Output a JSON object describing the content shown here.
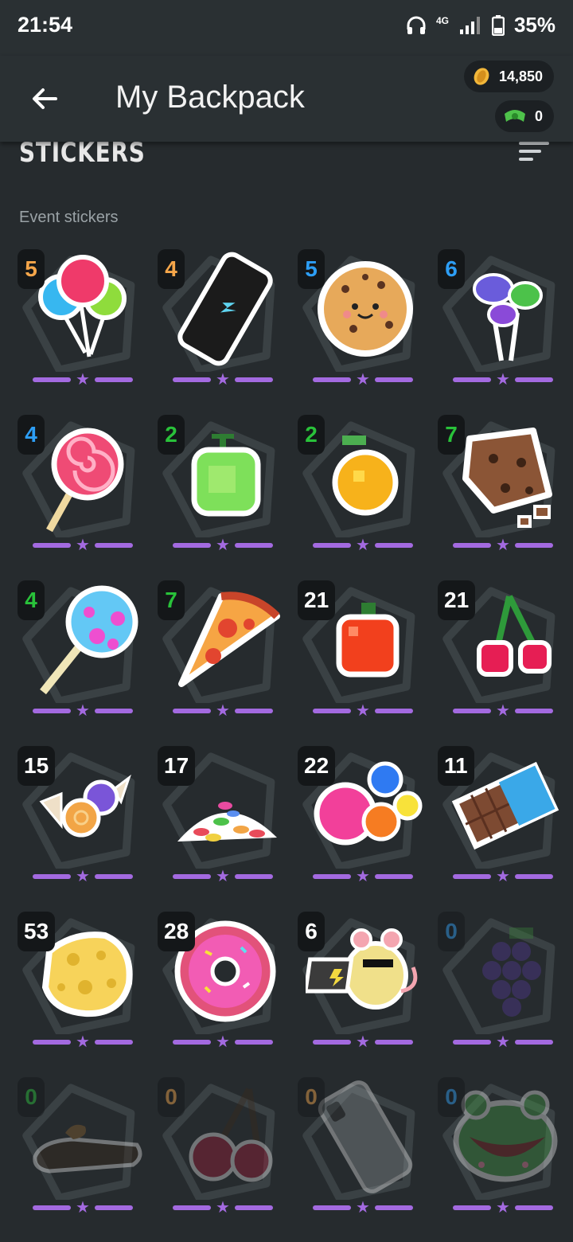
{
  "status": {
    "time": "21:54",
    "signal": "4G",
    "battery": "35%"
  },
  "header": {
    "title": "My Backpack",
    "coins": "14,850",
    "cash": "0"
  },
  "section": {
    "title": "STICKERS",
    "subtitle": "Event stickers"
  },
  "colors": {
    "orange": "#f5a64a",
    "blue": "#2d9ef5",
    "green": "#29c23a",
    "white": "#ffffff",
    "purple": "#a36ae0"
  },
  "stickers": [
    {
      "name": "balloons-lollipops",
      "count": "5",
      "color": "orange",
      "locked": false
    },
    {
      "name": "smartphone",
      "count": "4",
      "color": "orange",
      "locked": false
    },
    {
      "name": "cookie-face",
      "count": "5",
      "color": "blue",
      "locked": false
    },
    {
      "name": "wrapped-candies",
      "count": "6",
      "color": "blue",
      "locked": false
    },
    {
      "name": "swirl-lollipop",
      "count": "4",
      "color": "blue",
      "locked": false
    },
    {
      "name": "pixel-apple",
      "count": "2",
      "color": "green",
      "locked": false
    },
    {
      "name": "pixel-orange",
      "count": "2",
      "color": "green",
      "locked": false
    },
    {
      "name": "chocolate-cookie",
      "count": "7",
      "color": "green",
      "locked": false
    },
    {
      "name": "candy-lollipop",
      "count": "4",
      "color": "green",
      "locked": false
    },
    {
      "name": "pizza-slice",
      "count": "7",
      "color": "green",
      "locked": false
    },
    {
      "name": "pixel-tomato",
      "count": "21",
      "color": "white",
      "locked": false
    },
    {
      "name": "pixel-cherries",
      "count": "21",
      "color": "white",
      "locked": false
    },
    {
      "name": "wrapped-sweets",
      "count": "15",
      "color": "white",
      "locked": false
    },
    {
      "name": "jelly-beans",
      "count": "17",
      "color": "white",
      "locked": false
    },
    {
      "name": "gumballs",
      "count": "22",
      "color": "white",
      "locked": false
    },
    {
      "name": "chocolate-bar",
      "count": "11",
      "color": "white",
      "locked": false
    },
    {
      "name": "cheese",
      "count": "53",
      "color": "white",
      "locked": false
    },
    {
      "name": "donut",
      "count": "28",
      "color": "white",
      "locked": false
    },
    {
      "name": "hacker-mouse",
      "count": "6",
      "color": "white",
      "locked": false
    },
    {
      "name": "pixel-grapes",
      "count": "0",
      "color": "blue",
      "locked": true
    },
    {
      "name": "brownie",
      "count": "0",
      "color": "green",
      "locked": true
    },
    {
      "name": "cherries",
      "count": "0",
      "color": "orange",
      "locked": true
    },
    {
      "name": "phone-back",
      "count": "0",
      "color": "orange",
      "locked": true
    },
    {
      "name": "frog-face",
      "count": "0",
      "color": "blue",
      "locked": true
    }
  ]
}
